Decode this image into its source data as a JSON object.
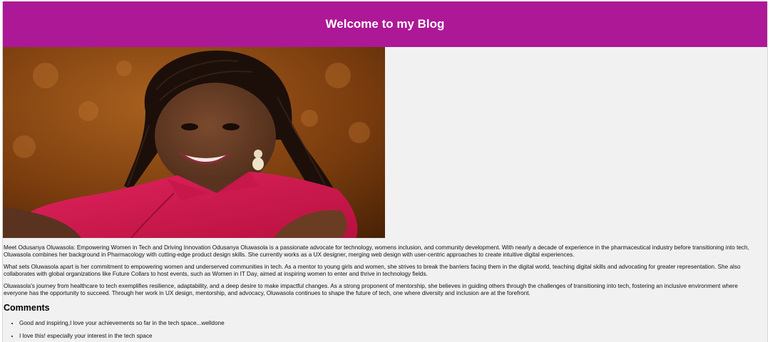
{
  "header": {
    "title": "Welcome to my Blog",
    "background": "#ad1896"
  },
  "image": {
    "alt": "Odusanya Oluwasola portrait"
  },
  "article": {
    "paragraphs": [
      "Meet Odusanya Oluwasola: Empowering Women in Tech and Driving Innovation Odusanya Oluwasola is a passionate advocate for technology, womens inclusion, and community development. With nearly a decade of experience in the pharmaceutical industry before transitioning into tech, Oluwasola combines her background in Pharmacology with cutting-edge product design skills. She currently works as a UX designer, merging web design with user-centric approaches to create intuitive digital experiences.",
      "What sets Oluwasola apart is her commitment to empowering women and underserved communities in tech. As a mentor to young girls and women, she strives to break the barriers facing them in the digital world, teaching digital skills and advocating for greater representation. She also collaborates with global organizations like Future Collars to host events, such as Women in IT Day, aimed at inspiring women to enter and thrive in technology fields.",
      "Oluwasola's journey from healthcare to tech exemplifies resilience, adaptability, and a deep desire to make impactful changes. As a strong proponent of mentorship, she believes in guiding others through the challenges of transitioning into tech, fostering an inclusive environment where everyone has the opportunity to succeed. Through her work in UX design, mentorship, and advocacy, Oluwasola continues to shape the future of tech, one where diversity and inclusion are at the forefront."
    ]
  },
  "comments": {
    "heading": "Comments",
    "items": [
      "Good and inspiring,I love your achievements so far in the tech space...welldone",
      "I love this! especially your interest in the tech space"
    ]
  }
}
